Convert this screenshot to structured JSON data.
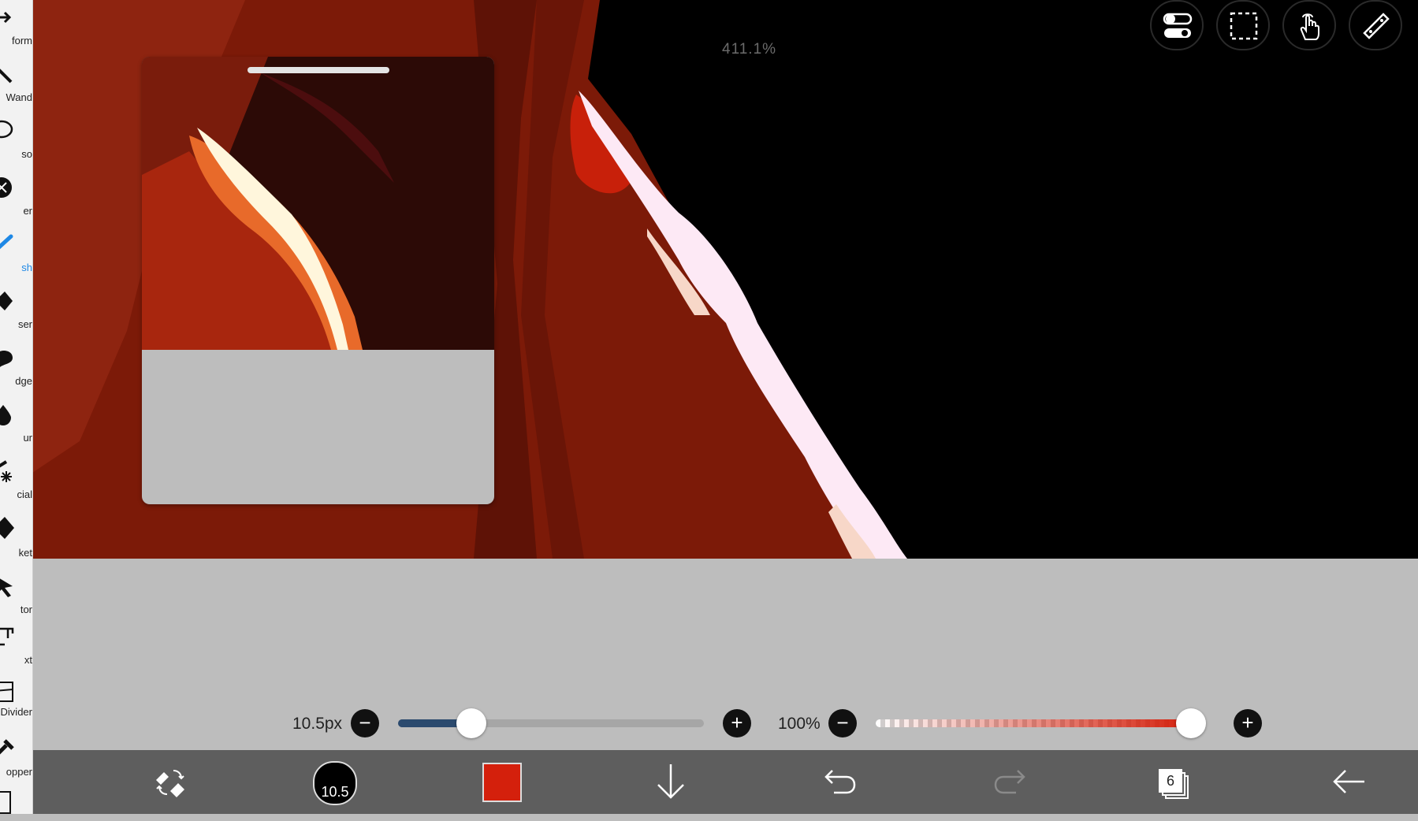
{
  "toolbar": {
    "tools": [
      {
        "label": "form",
        "icon": "transform-icon"
      },
      {
        "label": "Wand",
        "icon": "magic-wand-icon"
      },
      {
        "label": "so",
        "icon": "lasso-icon"
      },
      {
        "label": "er",
        "icon": "filter-icon"
      },
      {
        "label": "sh",
        "icon": "brush-icon",
        "active": true
      },
      {
        "label": "ser",
        "icon": "eraser-icon"
      },
      {
        "label": "dge",
        "icon": "smudge-icon"
      },
      {
        "label": "ur",
        "icon": "blur-icon"
      },
      {
        "label": "cial",
        "icon": "special-icon"
      },
      {
        "label": "ket",
        "icon": "bucket-icon"
      },
      {
        "label": "tor",
        "icon": "selector-icon"
      },
      {
        "label": "xt",
        "icon": "text-icon"
      },
      {
        "label": "Divider",
        "icon": "frame-divider-icon"
      },
      {
        "label": "opper",
        "icon": "eyedropper-icon"
      }
    ]
  },
  "canvas": {
    "zoom": "411.1%"
  },
  "top_buttons": [
    {
      "name": "toggle-settings-icon"
    },
    {
      "name": "selection-icon"
    },
    {
      "name": "hand-tool-icon"
    },
    {
      "name": "ruler-icon"
    }
  ],
  "brush_size": {
    "value_label": "10.5px",
    "level": 0.24
  },
  "opacity": {
    "value_label": "100%",
    "level": 1.0
  },
  "bottom_bar": {
    "brush_size_short": "10.5",
    "color": "#d4200c",
    "layer_count": "6"
  },
  "colors": {
    "accent_blue": "#1e88e5",
    "size_track_fill": "#2b4a6e",
    "opacity_red": "#d4200c"
  }
}
